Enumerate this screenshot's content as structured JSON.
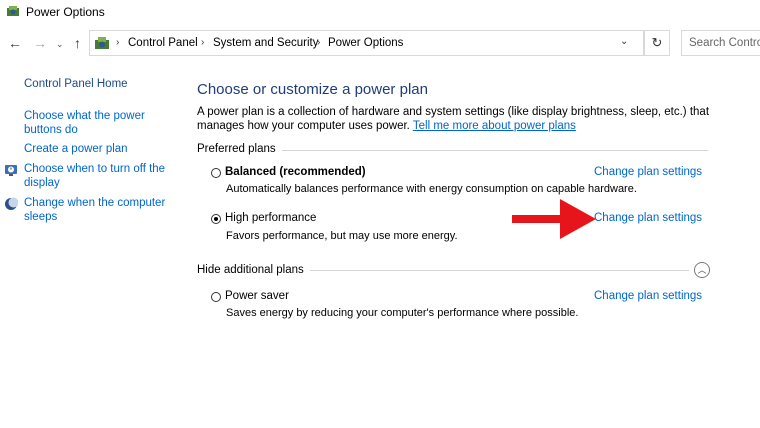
{
  "window": {
    "title": "Power Options"
  },
  "address_bar": {
    "crumbs": [
      "Control Panel",
      "System and Security",
      "Power Options"
    ],
    "search_placeholder": "Search Control Panel"
  },
  "left_pane": {
    "home": "Control Panel Home",
    "links": [
      "Choose what the power buttons do",
      "Create a power plan",
      "Choose when to turn off the display",
      "Change when the computer sleeps"
    ]
  },
  "main": {
    "heading": "Choose or customize a power plan",
    "intro": "A power plan is a collection of hardware and system settings (like display brightness, sleep, etc.) that manages how your computer uses power.",
    "intro_link": "Tell me more about power plans",
    "preferred_label": "Preferred plans",
    "hide_label": "Hide additional plans",
    "change_label": "Change plan settings",
    "plans": [
      {
        "name": "Balanced (recommended)",
        "desc": "Automatically balances performance with energy consumption on capable hardware.",
        "selected": false
      },
      {
        "name": "High performance",
        "desc": "Favors performance, but may use more energy.",
        "selected": true
      },
      {
        "name": "Power saver",
        "desc": "Saves energy by reducing your computer's performance where possible.",
        "selected": false
      }
    ]
  },
  "annotation": {
    "arrow_color": "#e8141b"
  },
  "colors": {
    "link": "#0066cc",
    "heading": "#1e3d78"
  }
}
